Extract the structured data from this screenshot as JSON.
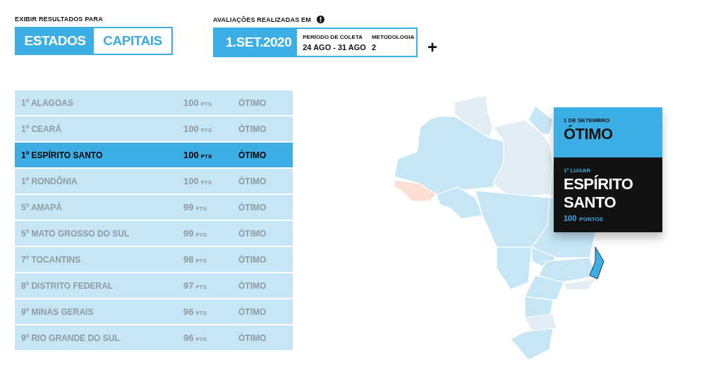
{
  "filter": {
    "label": "EXIBIR RESULTADOS PARA",
    "options": [
      {
        "label": "ESTADOS",
        "selected": true
      },
      {
        "label": "CAPITAIS",
        "selected": false
      }
    ]
  },
  "evaluation": {
    "label": "AVALIAÇÕES REALIZADAS EM",
    "date": "1.SET.2020",
    "period_label": "PERÍODO DE COLETA",
    "period": "24 AGO - 31 AGO",
    "method_label": "METODOLOGIA",
    "method": "2",
    "more": "+"
  },
  "ranking": [
    {
      "place": "1º ALAGOAS",
      "score": "100",
      "unit": "PTS",
      "rating": "ÓTIMO",
      "selected": false
    },
    {
      "place": "1º CEARÁ",
      "score": "100",
      "unit": "PTS",
      "rating": "ÓTIMO",
      "selected": false
    },
    {
      "place": "1º ESPÍRITO SANTO",
      "score": "100",
      "unit": "PTS",
      "rating": "ÓTIMO",
      "selected": true
    },
    {
      "place": "1º RONDÔNIA",
      "score": "100",
      "unit": "PTS",
      "rating": "ÓTIMO",
      "selected": false
    },
    {
      "place": "5º AMAPÁ",
      "score": "99",
      "unit": "PTS",
      "rating": "ÓTIMO",
      "selected": false
    },
    {
      "place": "5º MATO GROSSO DO SUL",
      "score": "99",
      "unit": "PTS",
      "rating": "ÓTIMO",
      "selected": false
    },
    {
      "place": "7º TOCANTINS",
      "score": "98",
      "unit": "PTS",
      "rating": "ÓTIMO",
      "selected": false
    },
    {
      "place": "8º DISTRITO FEDERAL",
      "score": "97",
      "unit": "PTS",
      "rating": "ÓTIMO",
      "selected": false
    },
    {
      "place": "9º MINAS GERAIS",
      "score": "96",
      "unit": "PTS",
      "rating": "ÓTIMO",
      "selected": false
    },
    {
      "place": "9º RIO GRANDE DO SUL",
      "score": "96",
      "unit": "PTS",
      "rating": "ÓTIMO",
      "selected": false
    }
  ],
  "tooltip": {
    "date": "1 DE SETEMBRO",
    "rating": "ÓTIMO",
    "place": "1º LUGAR",
    "name": "ESPÍRITO SANTO",
    "score": "100",
    "unit": "PONTOS"
  }
}
